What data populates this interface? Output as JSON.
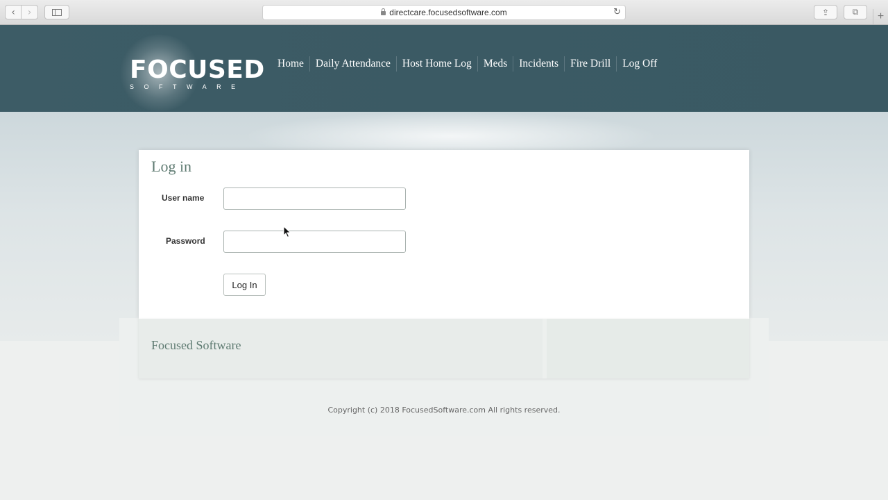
{
  "browser": {
    "url": "directcare.focusedsoftware.com",
    "back_icon": "‹",
    "forward_icon": "›",
    "reload_icon": "↻",
    "share_icon": "⇪",
    "tabs_icon": "⧉",
    "newtab_icon": "+"
  },
  "header": {
    "logo_main": "FOCUSED",
    "logo_sub": "SOFTWARE",
    "menu": [
      {
        "label": "Home"
      },
      {
        "label": "Daily Attendance"
      },
      {
        "label": "Host Home Log"
      },
      {
        "label": "Meds"
      },
      {
        "label": "Incidents"
      },
      {
        "label": "Fire Drill"
      },
      {
        "label": "Log Off"
      }
    ]
  },
  "login": {
    "title": "Log in",
    "username_label": "User name",
    "username_value": "",
    "password_label": "Password",
    "password_value": "",
    "submit_label": "Log In"
  },
  "footer": {
    "brand": "Focused Software",
    "copyright": "Copyright (c) 2018 FocusedSoftware.com All rights reserved."
  },
  "colors": {
    "header_bg": "#3b5a64",
    "accent_text": "#5f7b72"
  }
}
